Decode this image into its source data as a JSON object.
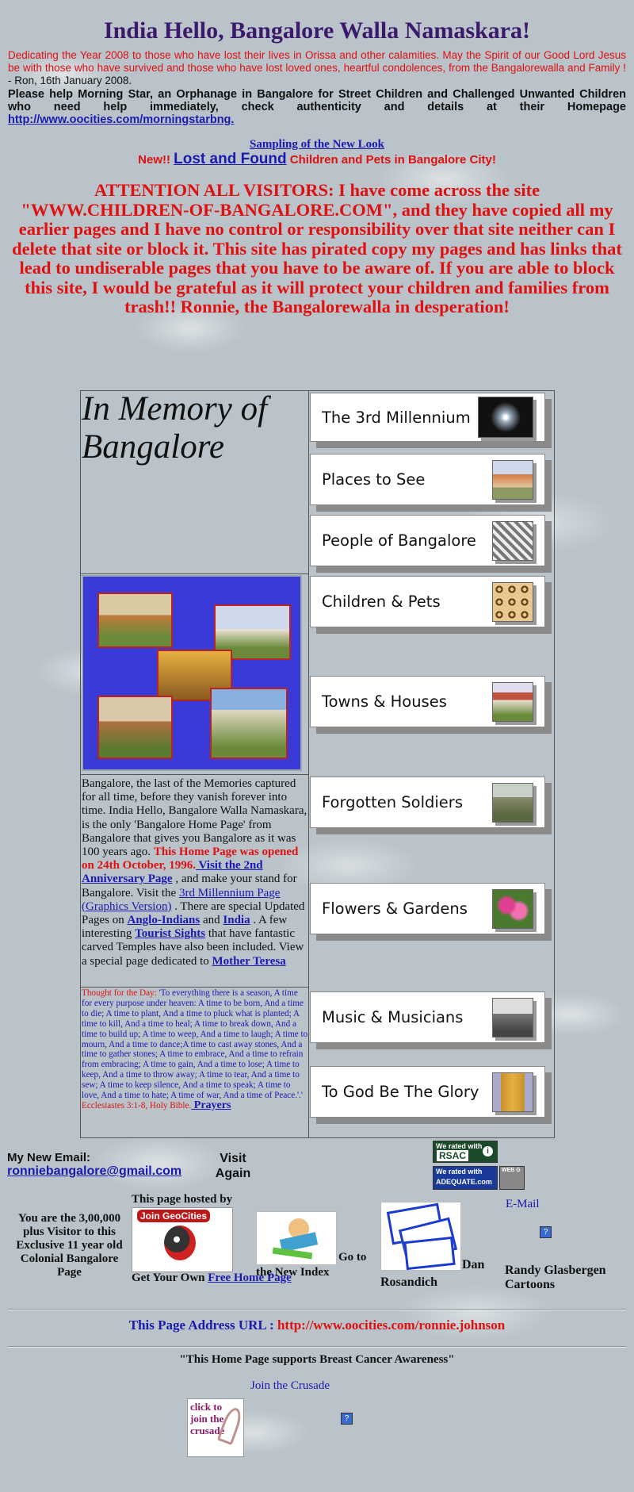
{
  "header": {
    "title": "India Hello, Bangalore Walla Namaskara!",
    "dedication": "Dedicating the Year 2008 to those who have lost their lives in Orissa and other calamities. May the Spirit of our Good Lord Jesus be with those who have survived and those who have lost loved ones, heartful condolences, from the Bangalorewalla and Family ! ",
    "dedication_sign": "- Ron, 16th January 2008.",
    "please_text": "Please help Morning Star, an Orphanage in Bangalore for Street Children and Challenged Unwanted Children who need help immediately, check authenticity and details at their Homepage ",
    "please_link": "http://www.oocities.com/morningstarbng.",
    "sampling": "Sampling of the New Look",
    "new_prefix": "New!! ",
    "lost_found": "Lost and Found",
    "new_suffix": " Children and Pets in Bangalore City!",
    "attention": "ATTENTION ALL VISITORS: I have come across the site \"WWW.CHILDREN-OF-BANGALORE.COM\", and they have copied all my earlier pages and I have no control or responsibility over that site neither can I delete that site or block it. This site has pirated copy my pages and has links that lead to undiserable pages that you have to be aware of. If you are able to block this site, I would be grateful as it will protect your children and families from trash!! Ronnie, the Bangalorewalla in desperation!"
  },
  "memory": {
    "title_line1": "In Memory of",
    "title_line2": "Bangalore"
  },
  "nav": [
    {
      "label": "The 3rd Millennium",
      "icon": "starburst-icon"
    },
    {
      "label": "Places to See",
      "icon": "palace-icon"
    },
    {
      "label": "People of Bangalore",
      "icon": "people-icon"
    },
    {
      "label": "Children & Pets",
      "icon": "pattern-icon"
    },
    {
      "label": "Towns & Houses",
      "icon": "house-icon"
    },
    {
      "label": "Forgotten Soldiers",
      "icon": "memorial-icon"
    },
    {
      "label": "Flowers & Gardens",
      "icon": "flower-icon"
    },
    {
      "label": "Music & Musicians",
      "icon": "band-icon"
    },
    {
      "label": "To God Be The Glory",
      "icon": "temple-icon"
    }
  ],
  "description": {
    "t1": "Bangalore, the last of the Memories captured for all time, before they vanish forever into time. India Hello, Bangalore Walla Namaskara, is the only 'Bangalore Home Page' from Bangalore that gives you Bangalore as it was 100 years ago. ",
    "red": "This Home Page was opened on 24th October, 1996.",
    "link1": " Visit the 2nd Anniversary Page",
    "t2": " , and make your stand for Bangalore. Visit the ",
    "link2": "3rd Millennium Page (Graphics Version)",
    "t3": " . There are special Updated Pages on ",
    "link3": "Anglo-Indians",
    "t4": " and ",
    "link4": "India",
    "t5": " . A few interesting ",
    "link5": "Tourist Sights",
    "t6": " that have fantastic carved Temples have also been included. View a special page dedicated to ",
    "link6": "Mother Teresa"
  },
  "thought": {
    "label": "Thought for the Day: ",
    "text": "'To everything there is a season, A time for every purpose under heaven: A time to be born, And a time to die; A time to plant, And a time to pluck what is planted; A time to kill, And a time to heal; A time to break down, And a time to build up; A time to weep, And a time to laugh; A time to mourn, And a time to dance;A time to cast away stones, And a time to gather stones; A time to embrace, And a time to refrain from embracing; A time to gain, And a time to lose; A time to keep, And a time to throw away; A time to tear, And a time to sew; A time to keep silence, And a time to speak; A time to love, And a time to hate; A time of war, And a time of Peace.'.'",
    "ref": " Ecclesiastes 3:1-8, Holy Bible.",
    "prayers": " Prayers"
  },
  "footer": {
    "email_label": "My New Email:",
    "email": "ronniebangalore@gmail.com",
    "visit": "Visit Again",
    "rsac_top": "We rated with",
    "rsac": "RSAC",
    "adequate_top": "We rated with",
    "adequate": "ADEQUATE.com",
    "webg": "WEB G",
    "visitor_text": "You are the 3,00,000 plus Visitor to this Exclusive 11 year old Colonial Bangalore Page",
    "hosted": "This page hosted by",
    "geocities": "Join GeoCities",
    "get_own": "Get Your Own ",
    "free_home": "Free Home Page",
    "goto": "Go to",
    "new_index": "the New Index",
    "dan": "Dan",
    "rosandich": "Rosandich",
    "email_right": "E-Mail",
    "randy": "Randy Glasbergen Cartoons",
    "url_label": "This Page Address URL : ",
    "url": "http://www.oocities.com/ronnie.johnson",
    "breast": "\"This Home Page supports Breast Cancer Awareness\"",
    "crusade": "Join the Crusade",
    "crusade_badge": "click to join the crusade"
  }
}
